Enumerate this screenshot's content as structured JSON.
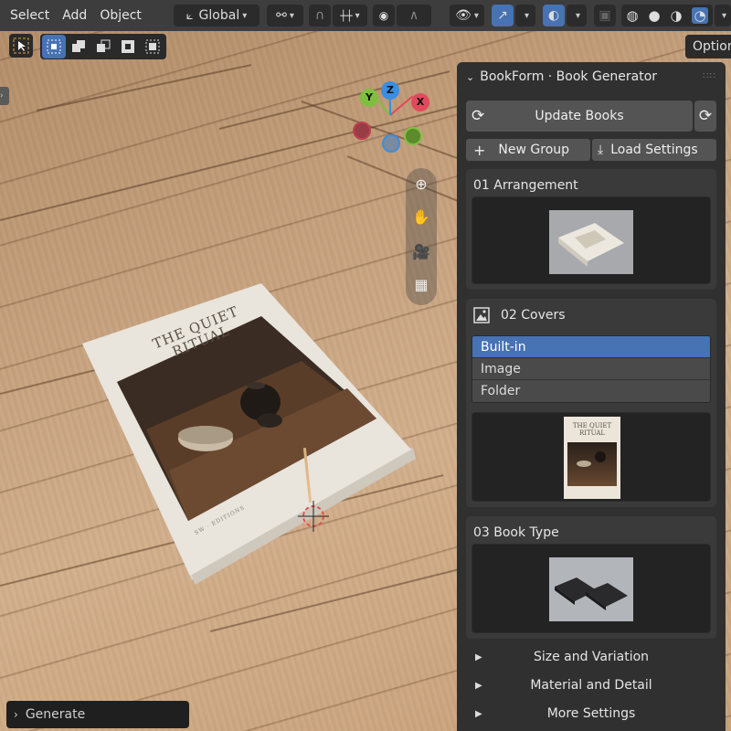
{
  "header": {
    "menus": [
      "Select",
      "Add",
      "Object"
    ],
    "transform_orientation": "Global"
  },
  "tool_options": {
    "options_label": "Options"
  },
  "gizmo": {
    "x_label": "X",
    "y_label": "Y",
    "z_label": "Z"
  },
  "book": {
    "title_line1": "THE QUIET",
    "title_line2": "RITUAL",
    "spine_footer": "SW · EDITIONS"
  },
  "panel": {
    "title": "BookForm · Book Generator",
    "update_label": "Update Books",
    "new_group_label": "New Group",
    "load_settings_label": "Load Settings",
    "sections": [
      {
        "title": "01  Arrangement"
      },
      {
        "title": "02  Covers"
      },
      {
        "title": "03  Book Type"
      }
    ],
    "cover_sources": [
      "Built-in",
      "Image",
      "Folder"
    ],
    "cover_selected": "Built-in",
    "collapsed": [
      "Size and Variation",
      "Material and Detail",
      "More Settings"
    ]
  },
  "operator_panel": {
    "label": "Generate"
  },
  "colors": {
    "accent": "#4772b3",
    "panel_bg": "#303030",
    "header_bg": "#3d3d3d"
  }
}
